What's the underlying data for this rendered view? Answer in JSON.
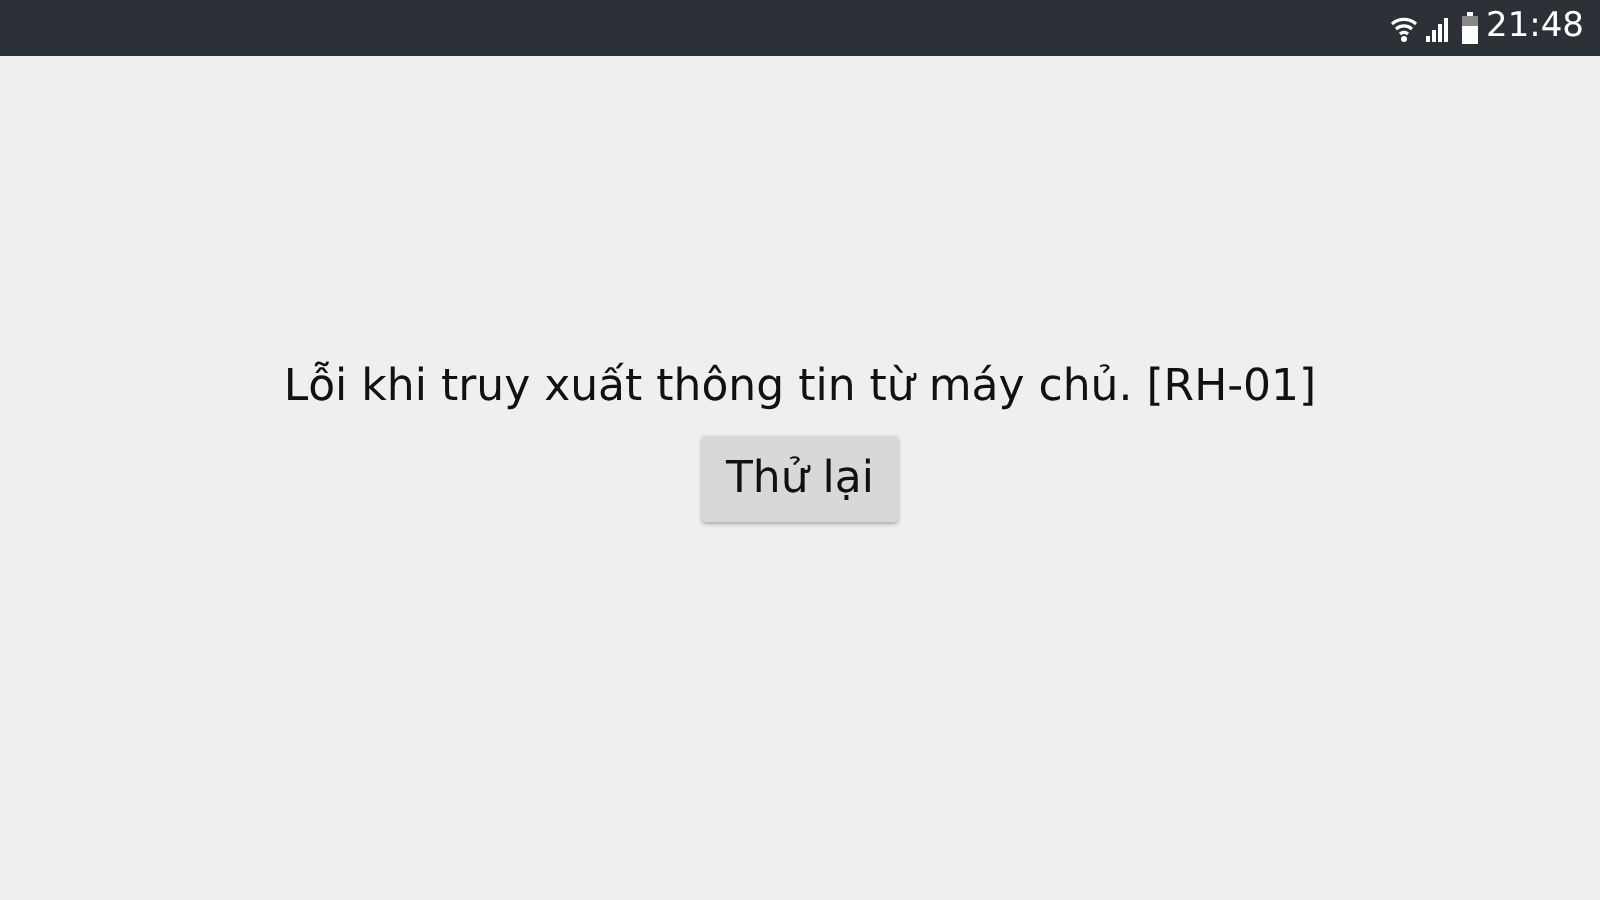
{
  "status_bar": {
    "time": "21:48"
  },
  "error": {
    "message": "Lỗi khi truy xuất thông tin từ máy chủ. [RH-01]",
    "button": "Thử lại"
  }
}
